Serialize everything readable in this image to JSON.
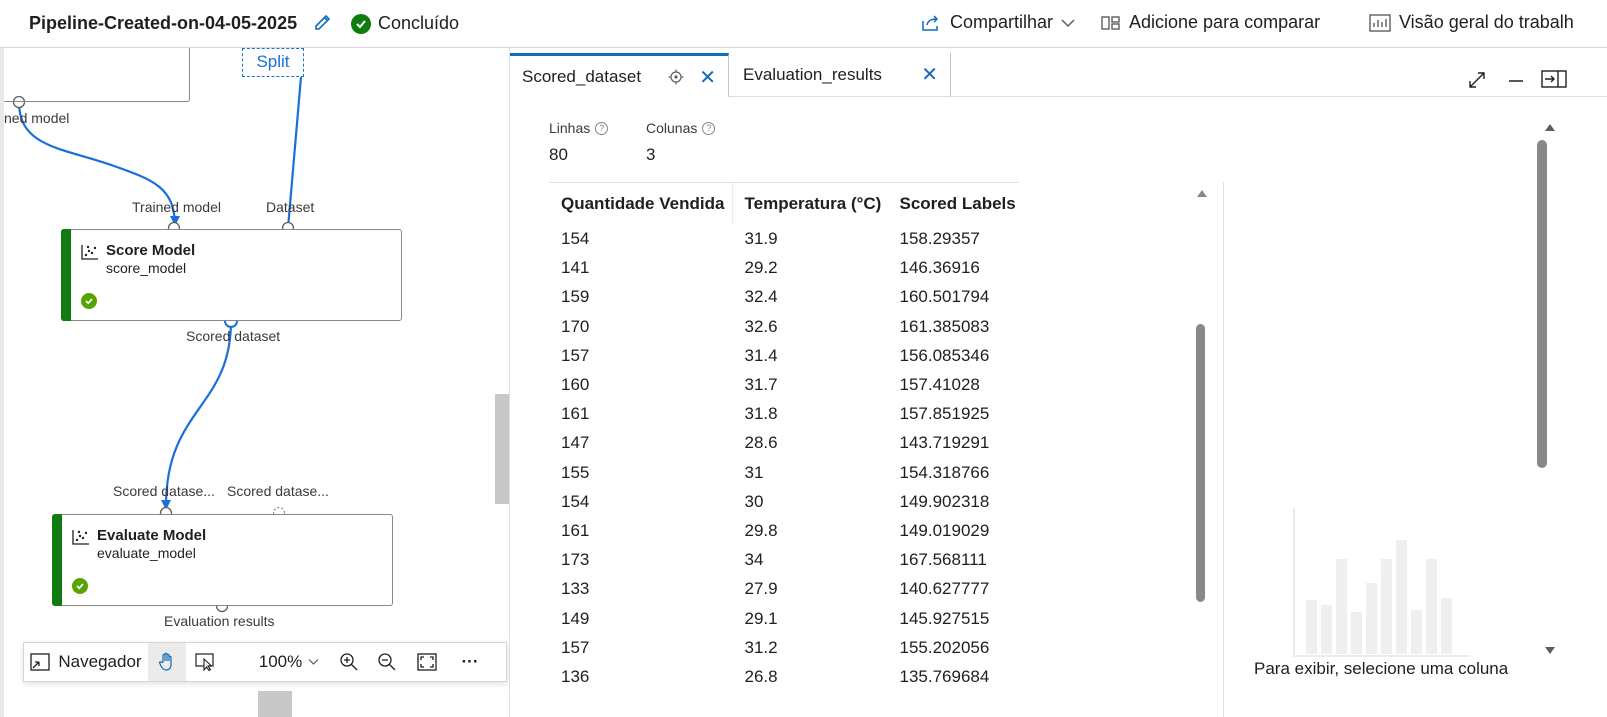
{
  "header": {
    "pipeline_title": "Pipeline-Created-on-04-05-2025",
    "status": "Concluído",
    "share_label": "Compartilhar",
    "compare_label": "Adicione para comparar",
    "overview_label": "Visão geral do trabalh"
  },
  "canvas": {
    "split_label": "Split",
    "trained_model_out": "ned model",
    "score_model": {
      "in_left": "Trained model",
      "in_right": "Dataset",
      "title": "Score Model",
      "subtitle": "score_model",
      "out": "Scored dataset"
    },
    "evaluate_model": {
      "in_left": "Scored datase...",
      "in_right": "Scored datase...",
      "title": "Evaluate Model",
      "subtitle": "evaluate_model",
      "out": "Evaluation results"
    },
    "toolbar": {
      "navigator_label": "Navegador",
      "zoom_value": "100%",
      "more_label": "···"
    }
  },
  "panel": {
    "tabs": [
      {
        "label": "Scored_dataset"
      },
      {
        "label": "Evaluation_results"
      }
    ],
    "rows_label": "Linhas",
    "rows_value": "80",
    "cols_label": "Colunas",
    "cols_value": "3",
    "columns": [
      "Quantidade Vendida",
      "Temperatura (°C)",
      "Scored Labels"
    ],
    "rows": [
      [
        "154",
        "31.9",
        "158.29357"
      ],
      [
        "141",
        "29.2",
        "146.36916"
      ],
      [
        "159",
        "32.4",
        "160.501794"
      ],
      [
        "170",
        "32.6",
        "161.385083"
      ],
      [
        "157",
        "31.4",
        "156.085346"
      ],
      [
        "160",
        "31.7",
        "157.41028"
      ],
      [
        "161",
        "31.8",
        "157.851925"
      ],
      [
        "147",
        "28.6",
        "143.719291"
      ],
      [
        "155",
        "31",
        "154.318766"
      ],
      [
        "154",
        "30",
        "149.902318"
      ],
      [
        "161",
        "29.8",
        "149.019029"
      ],
      [
        "173",
        "34",
        "167.568111"
      ],
      [
        "133",
        "27.9",
        "140.627777"
      ],
      [
        "149",
        "29.1",
        "145.927515"
      ],
      [
        "157",
        "31.2",
        "155.202056"
      ],
      [
        "136",
        "26.8",
        "135.769684"
      ]
    ],
    "empty_message": "Para exibir, selecione uma coluna"
  },
  "colors": {
    "accent": "#0f6cbd",
    "success": "#107c10",
    "wire": "#1a6fd9"
  }
}
